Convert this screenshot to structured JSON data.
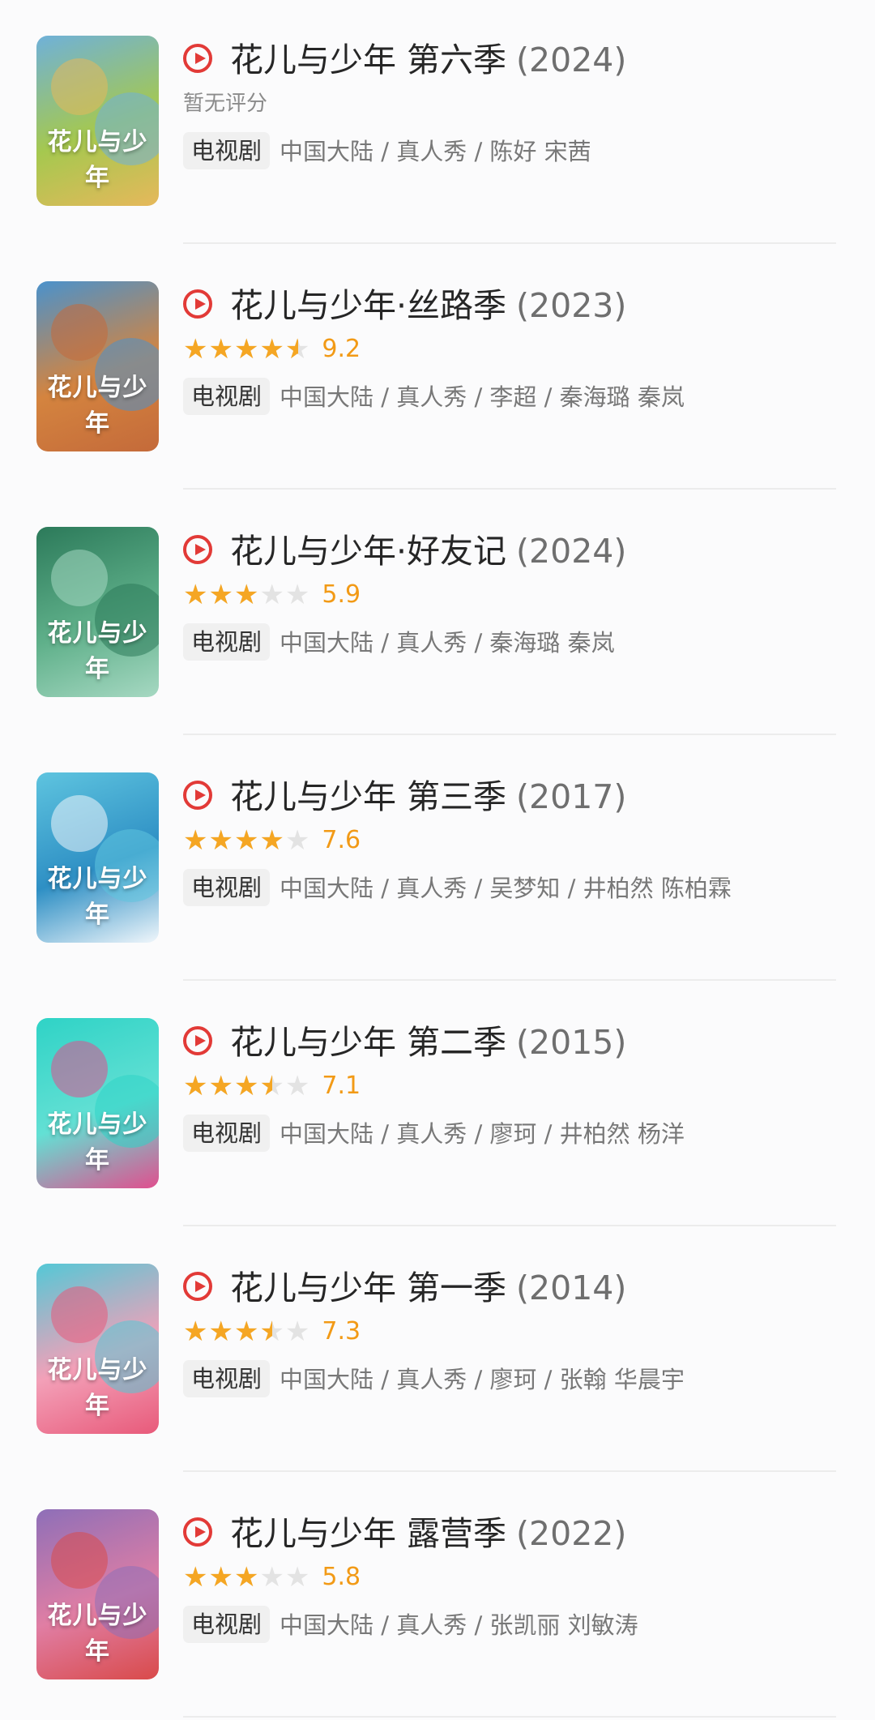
{
  "shows": [
    {
      "title": "花儿与少年 第六季",
      "year": "(2024)",
      "rating_text": "暂无评分",
      "score": "",
      "stars": 0,
      "type": "电视剧",
      "meta": "中国大陆 / 真人秀 / 陈好 宋茜",
      "poster_colors": [
        "#6fb1d9",
        "#a5c84f",
        "#e6b85b"
      ]
    },
    {
      "title": "花儿与少年·丝路季",
      "year": "(2023)",
      "rating_text": "",
      "score": "9.2",
      "stars": 4.5,
      "type": "电视剧",
      "meta": "中国大陆 / 真人秀 / 李超 / 秦海璐 秦岚",
      "poster_colors": [
        "#4a92cc",
        "#d4843f",
        "#c46a3a"
      ]
    },
    {
      "title": "花儿与少年·好友记",
      "year": "(2024)",
      "rating_text": "",
      "score": "5.9",
      "stars": 3,
      "type": "电视剧",
      "meta": "中国大陆 / 真人秀 / 秦海璐 秦岚",
      "poster_colors": [
        "#2c7a5a",
        "#5fb08a",
        "#a6d8c2"
      ]
    },
    {
      "title": "花儿与少年 第三季",
      "year": "(2017)",
      "rating_text": "",
      "score": "7.6",
      "stars": 4,
      "type": "电视剧",
      "meta": "中国大陆 / 真人秀 / 吴梦知 / 井柏然 陈柏霖",
      "poster_colors": [
        "#5ec4df",
        "#2e8fc4",
        "#f0f6fb"
      ]
    },
    {
      "title": "花儿与少年 第二季",
      "year": "(2015)",
      "rating_text": "",
      "score": "7.1",
      "stars": 3.5,
      "type": "电视剧",
      "meta": "中国大陆 / 真人秀 / 廖珂 / 井柏然 杨洋",
      "poster_colors": [
        "#2fd3c6",
        "#63e0d4",
        "#e04f8e"
      ]
    },
    {
      "title": "花儿与少年 第一季",
      "year": "(2014)",
      "rating_text": "",
      "score": "7.3",
      "stars": 3.5,
      "type": "电视剧",
      "meta": "中国大陆 / 真人秀 / 廖珂 / 张翰 华晨宇",
      "poster_colors": [
        "#54c8d6",
        "#f3a0b8",
        "#e85a7a"
      ]
    },
    {
      "title": "花儿与少年 露营季",
      "year": "(2022)",
      "rating_text": "",
      "score": "5.8",
      "stars": 3,
      "type": "电视剧",
      "meta": "中国大陆 / 真人秀 / 张凯丽 刘敏涛",
      "poster_colors": [
        "#8e6fb8",
        "#e07ea4",
        "#d94a4a"
      ]
    }
  ],
  "poster_caption": "花儿与少年",
  "star_glyphs": "★★★★★"
}
